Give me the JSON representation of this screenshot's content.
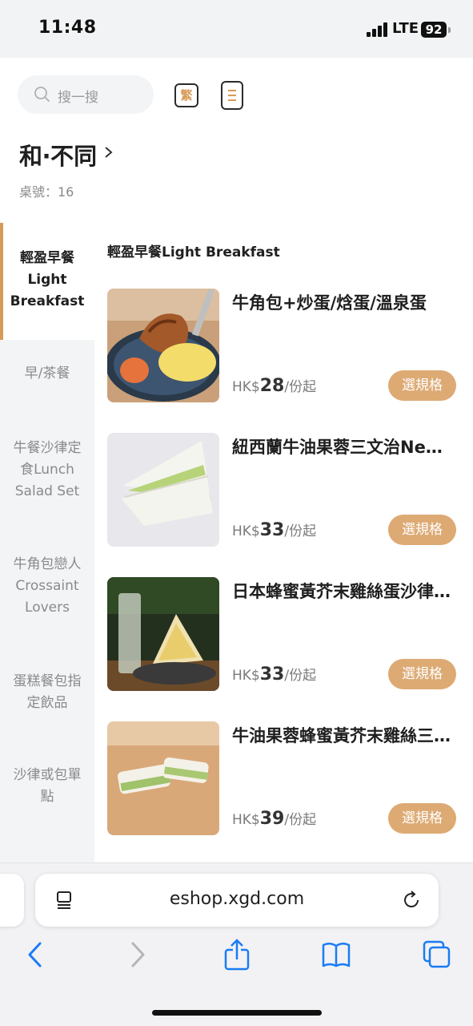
{
  "status_bar": {
    "time": "11:48",
    "network": "LTE",
    "battery": "92"
  },
  "header": {
    "search_placeholder": "搜一搜",
    "language_button": "繁",
    "shop_name": "和‧不同",
    "table_label": "桌號：16"
  },
  "sidebar": {
    "categories": [
      {
        "label": "輕盈早餐\nLight\nBreakfast",
        "active": true
      },
      {
        "label": "早/茶餐",
        "active": false
      },
      {
        "label": "牛餐沙律定\n食Lunch\nSalad Set",
        "active": false
      },
      {
        "label": "牛角包戀人\nCrossaint\nLovers",
        "active": false
      },
      {
        "label": "蛋糕餐包指\n定飲品",
        "active": false
      },
      {
        "label": "沙律或包單\n點",
        "active": false
      }
    ]
  },
  "menu": {
    "section_title": "輕盈早餐Light Breakfast",
    "items": [
      {
        "name": "牛角包+炒蛋/焓蛋/溫泉蛋",
        "currency": "HK$",
        "price": "28",
        "unit": "/份起",
        "button": "選規格"
      },
      {
        "name": "紐西蘭牛油果蓉三文治New Zealand",
        "currency": "HK$",
        "price": "33",
        "unit": "/份起",
        "button": "選規格"
      },
      {
        "name": "日本蜂蜜黃芥末雞絲蛋沙律三文治",
        "currency": "HK$",
        "price": "33",
        "unit": "/份起",
        "button": "選規格"
      },
      {
        "name": "牛油果蓉蜂蜜黃芥末雞絲三文治",
        "currency": "HK$",
        "price": "39",
        "unit": "/份起",
        "button": "選規格"
      }
    ]
  },
  "browser": {
    "url": "eshop.xgd.com"
  },
  "colors": {
    "accent": "#ddaa74",
    "accent_dark": "#d79b58",
    "ios_blue": "#1a7cf5"
  }
}
